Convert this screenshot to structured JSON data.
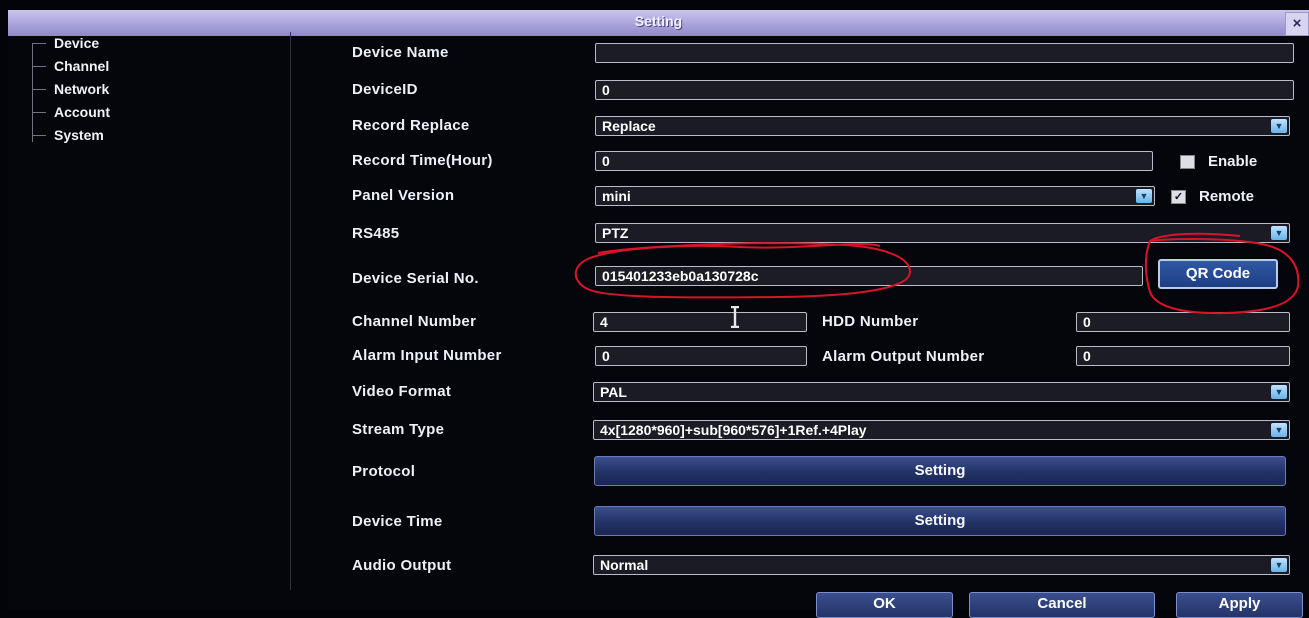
{
  "window": {
    "title": "Setting",
    "close_glyph": "×"
  },
  "sidebar": {
    "items": [
      {
        "label": "Device"
      },
      {
        "label": "Channel"
      },
      {
        "label": "Network"
      },
      {
        "label": "Account"
      },
      {
        "label": "System"
      }
    ]
  },
  "form": {
    "device_name": {
      "label": "Device Name",
      "value": ""
    },
    "device_id": {
      "label": "DeviceID",
      "value": "0"
    },
    "record_replace": {
      "label": "Record Replace",
      "value": "Replace"
    },
    "record_time": {
      "label": "Record Time(Hour)",
      "value": "0",
      "checkbox_label": "Enable",
      "checked": false
    },
    "panel_version": {
      "label": "Panel Version",
      "value": "mini",
      "checkbox_label": "Remote",
      "checked": true
    },
    "rs485": {
      "label": "RS485",
      "value": "PTZ"
    },
    "serial": {
      "label": "Device Serial No.",
      "value": "015401233eb0a130728c",
      "button_label": "QR Code"
    },
    "channel_number": {
      "label": "Channel Number",
      "value": "4"
    },
    "hdd_number": {
      "label": "HDD Number",
      "value": "0"
    },
    "alarm_input": {
      "label": "Alarm Input Number",
      "value": "0"
    },
    "alarm_output": {
      "label": "Alarm Output Number",
      "value": "0"
    },
    "video_format": {
      "label": "Video Format",
      "value": "PAL"
    },
    "stream_type": {
      "label": "Stream Type",
      "value": "4x[1280*960]+sub[960*576]+1Ref.+4Play"
    },
    "protocol": {
      "label": "Protocol",
      "button_label": "Setting"
    },
    "device_time": {
      "label": "Device Time",
      "button_label": "Setting"
    },
    "audio_output": {
      "label": "Audio Output",
      "value": "Normal"
    }
  },
  "footer": {
    "ok_label": "OK",
    "cancel_label": "Cancel",
    "apply_label": "Apply"
  },
  "colors": {
    "annotation": "#d8142a",
    "titlebar": "#a9a3dd",
    "button": "#223266"
  },
  "icons": {
    "dropdown": "dropdown-arrow-icon",
    "close": "close-icon",
    "cursor": "text-cursor-icon"
  }
}
